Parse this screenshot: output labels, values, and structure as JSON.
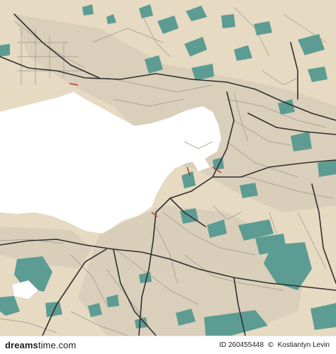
{
  "map": {
    "colors": {
      "land": "#e6dac2",
      "water": "#ffffff",
      "park": "#5c9c93",
      "road_minor": "#9c968c",
      "road_major": "#2f2f2f",
      "urban": "#cfc6b4",
      "accent": "#b4413a"
    }
  },
  "footer": {
    "logo_bold": "dreams",
    "logo_rest": "time",
    "logo_suffix": ".com",
    "id_label": "ID 260455448",
    "author": "Kostiantyn Levin",
    "separator": "©"
  }
}
